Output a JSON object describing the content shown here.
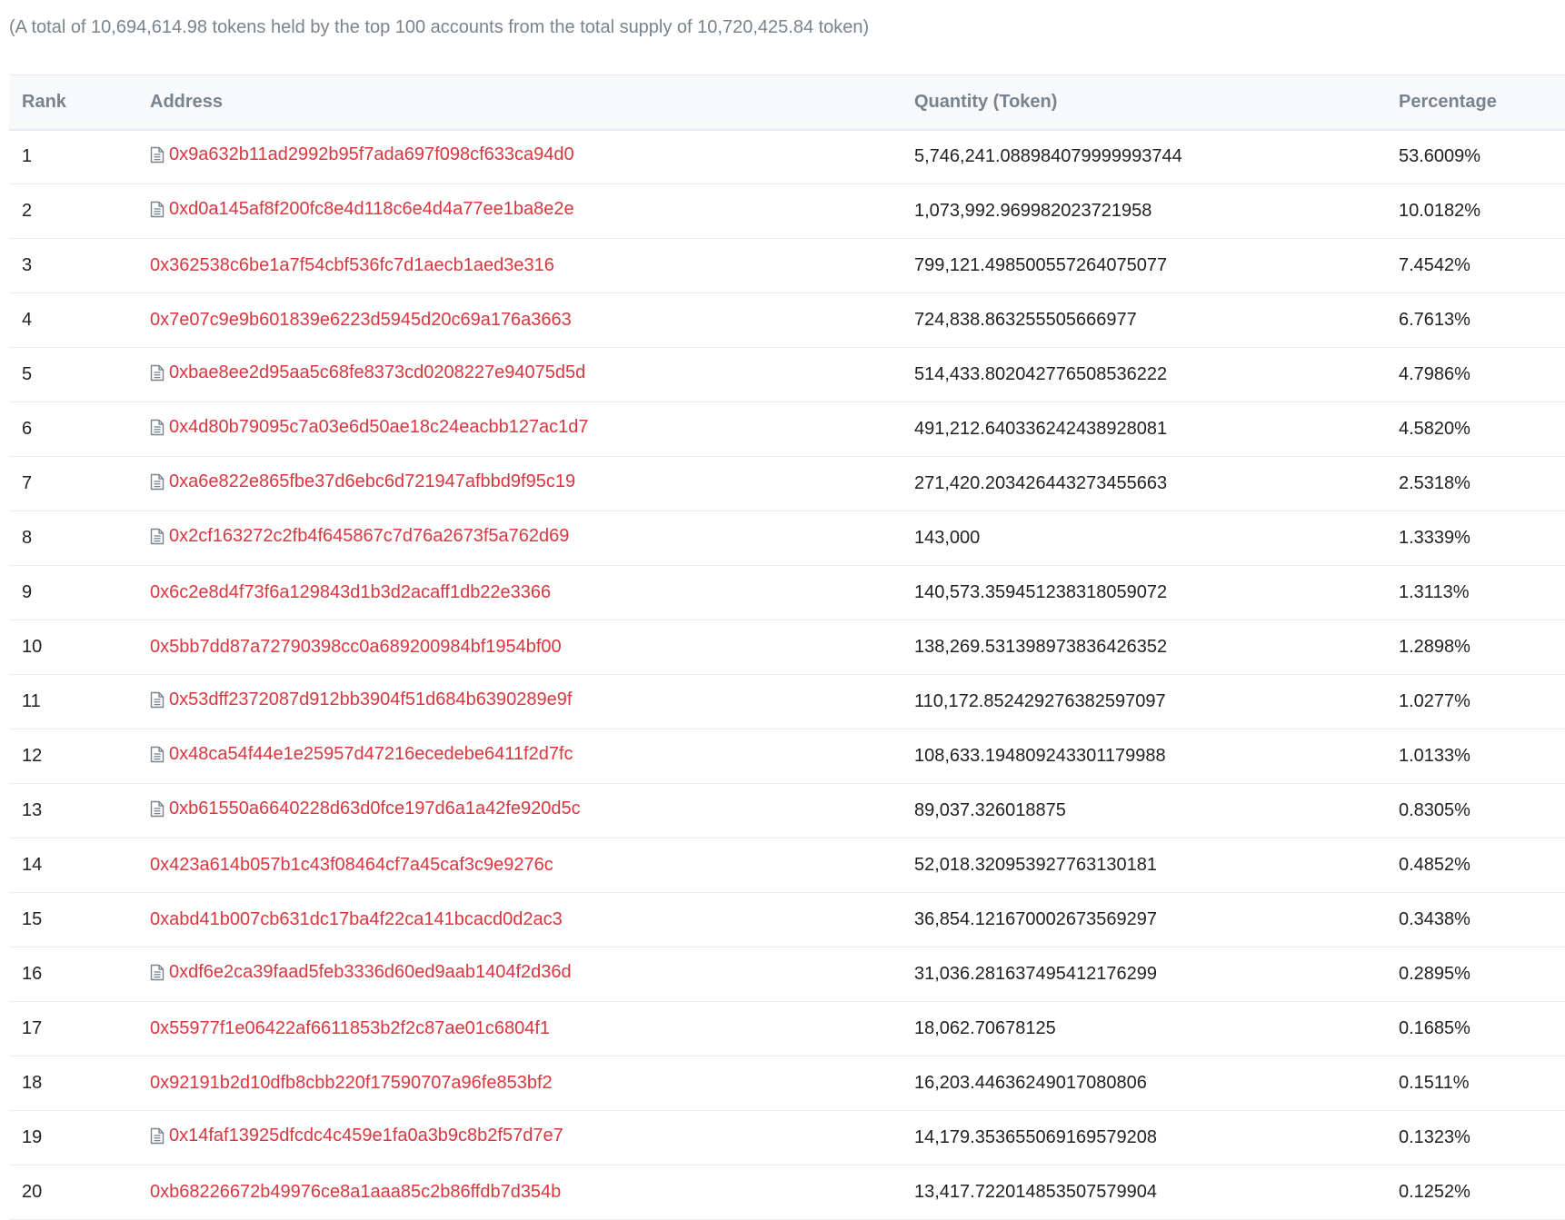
{
  "summary": "(A total of 10,694,614.98 tokens held by the top 100 accounts from the total supply of 10,720,425.84 token)",
  "table": {
    "headers": {
      "rank": "Rank",
      "address": "Address",
      "quantity": "Quantity (Token)",
      "percentage": "Percentage"
    },
    "rows": [
      {
        "rank": "1",
        "address": "0x9a632b11ad2992b95f7ada697f098cf633ca94d0",
        "is_contract": true,
        "quantity": "5,746,241.088984079999993744",
        "percentage": "53.6009%"
      },
      {
        "rank": "2",
        "address": "0xd0a145af8f200fc8e4d118c6e4d4a77ee1ba8e2e",
        "is_contract": true,
        "quantity": "1,073,992.969982023721958",
        "percentage": "10.0182%"
      },
      {
        "rank": "3",
        "address": "0x362538c6be1a7f54cbf536fc7d1aecb1aed3e316",
        "is_contract": false,
        "quantity": "799,121.498500557264075077",
        "percentage": "7.4542%"
      },
      {
        "rank": "4",
        "address": "0x7e07c9e9b601839e6223d5945d20c69a176a3663",
        "is_contract": false,
        "quantity": "724,838.863255505666977",
        "percentage": "6.7613%"
      },
      {
        "rank": "5",
        "address": "0xbae8ee2d95aa5c68fe8373cd0208227e94075d5d",
        "is_contract": true,
        "quantity": "514,433.802042776508536222",
        "percentage": "4.7986%"
      },
      {
        "rank": "6",
        "address": "0x4d80b79095c7a03e6d50ae18c24eacbb127ac1d7",
        "is_contract": true,
        "quantity": "491,212.640336242438928081",
        "percentage": "4.5820%"
      },
      {
        "rank": "7",
        "address": "0xa6e822e865fbe37d6ebc6d721947afbbd9f95c19",
        "is_contract": true,
        "quantity": "271,420.203426443273455663",
        "percentage": "2.5318%"
      },
      {
        "rank": "8",
        "address": "0x2cf163272c2fb4f645867c7d76a2673f5a762d69",
        "is_contract": true,
        "quantity": "143,000",
        "percentage": "1.3339%"
      },
      {
        "rank": "9",
        "address": "0x6c2e8d4f73f6a129843d1b3d2acaff1db22e3366",
        "is_contract": false,
        "quantity": "140,573.359451238318059072",
        "percentage": "1.3113%"
      },
      {
        "rank": "10",
        "address": "0x5bb7dd87a72790398cc0a689200984bf1954bf00",
        "is_contract": false,
        "quantity": "138,269.531398973836426352",
        "percentage": "1.2898%"
      },
      {
        "rank": "11",
        "address": "0x53dff2372087d912bb3904f51d684b6390289e9f",
        "is_contract": true,
        "quantity": "110,172.852429276382597097",
        "percentage": "1.0277%"
      },
      {
        "rank": "12",
        "address": "0x48ca54f44e1e25957d47216ecedebe6411f2d7fc",
        "is_contract": true,
        "quantity": "108,633.194809243301179988",
        "percentage": "1.0133%"
      },
      {
        "rank": "13",
        "address": "0xb61550a6640228d63d0fce197d6a1a42fe920d5c",
        "is_contract": true,
        "quantity": "89,037.326018875",
        "percentage": "0.8305%"
      },
      {
        "rank": "14",
        "address": "0x423a614b057b1c43f08464cf7a45caf3c9e9276c",
        "is_contract": false,
        "quantity": "52,018.320953927763130181",
        "percentage": "0.4852%"
      },
      {
        "rank": "15",
        "address": "0xabd41b007cb631dc17ba4f22ca141bcacd0d2ac3",
        "is_contract": false,
        "quantity": "36,854.121670002673569297",
        "percentage": "0.3438%"
      },
      {
        "rank": "16",
        "address": "0xdf6e2ca39faad5feb3336d60ed9aab1404f2d36d",
        "is_contract": true,
        "quantity": "31,036.281637495412176299",
        "percentage": "0.2895%"
      },
      {
        "rank": "17",
        "address": "0x55977f1e06422af6611853b2f2c87ae01c6804f1",
        "is_contract": false,
        "quantity": "18,062.70678125",
        "percentage": "0.1685%"
      },
      {
        "rank": "18",
        "address": "0x92191b2d10dfb8cbb220f17590707a96fe853bf2",
        "is_contract": false,
        "quantity": "16,203.44636249017080806",
        "percentage": "0.1511%"
      },
      {
        "rank": "19",
        "address": "0x14faf13925dfcdc4c459e1fa0a3b9c8b2f57d7e7",
        "is_contract": true,
        "quantity": "14,179.353655069169579208",
        "percentage": "0.1323%"
      },
      {
        "rank": "20",
        "address": "0xb68226672b49976ce8a1aaa85c2b86ffdb7d354b",
        "is_contract": false,
        "quantity": "13,417.722014853507579904",
        "percentage": "0.1252%"
      }
    ]
  },
  "icons": {
    "contract": "file-text-icon"
  },
  "colors": {
    "link": "#d9363e",
    "muted": "#77838f",
    "text": "#1e2022",
    "border": "#e7eaf3",
    "header_bg": "#f8f9fa"
  }
}
